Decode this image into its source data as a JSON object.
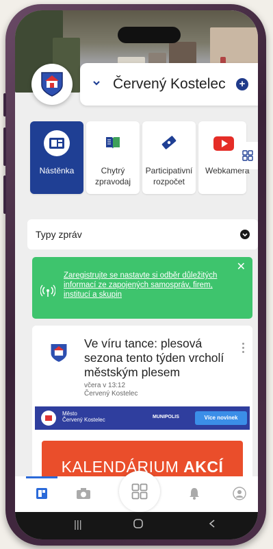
{
  "header": {
    "city_name": "Červený Kostelec"
  },
  "tiles": [
    {
      "label": "Nástěnka",
      "icon": "bulletin-board-icon",
      "active": true
    },
    {
      "label": "Chytrý zpravodaj",
      "icon": "book-icon",
      "active": false
    },
    {
      "label": "Participativní rozpočet",
      "icon": "ticket-icon",
      "active": false
    },
    {
      "label": "Webkamera",
      "icon": "youtube-icon",
      "active": false
    }
  ],
  "filter": {
    "label": "Typy zpráv"
  },
  "banner": {
    "text": "Zaregistrujte se nastavte si odběr důležitých informací ze zapojených samospráv, firem, institucí a skupin",
    "close": "✕"
  },
  "article": {
    "title": "Ve víru tance: plesová sezona tento týden vrcholí městským plesem",
    "date": "včera v 13:12",
    "author": "Červený Kostelec",
    "newsletter": {
      "city_line1": "Město",
      "city_line2": "Červený Kostelec",
      "brand": "MUNIPOLIS",
      "button": "Více novinek"
    },
    "poster_normal": "KALENDÁRIUM",
    "poster_bold": "AKCÍ"
  },
  "colors": {
    "primary": "#1f3f94",
    "banner_green": "#3ec46d",
    "poster_orange": "#ea4e2b"
  }
}
